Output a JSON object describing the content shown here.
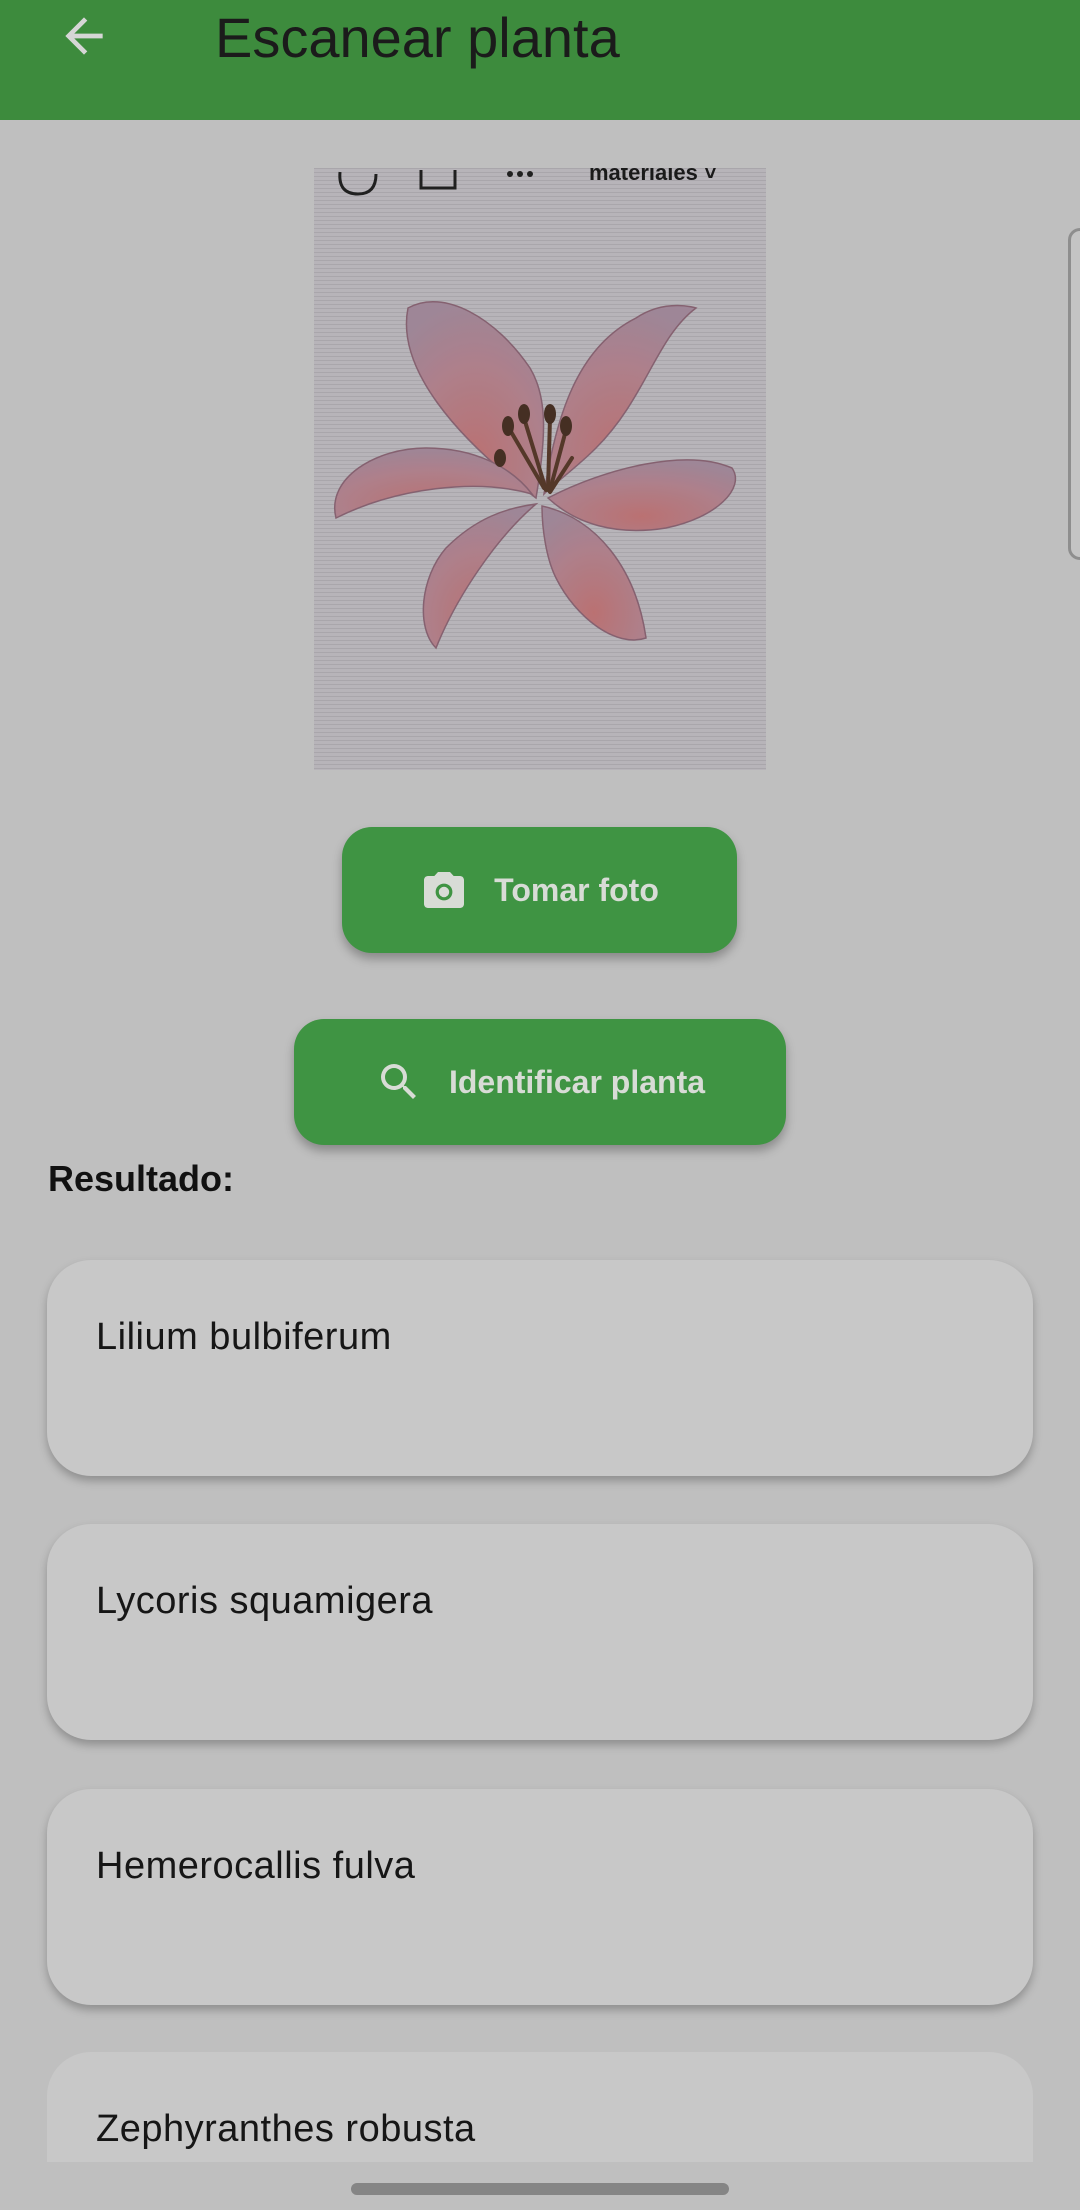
{
  "app_bar": {
    "title": "Escanear planta",
    "back_icon": "arrow-left-icon"
  },
  "photo": {
    "toolbar_text": "materiales ˅"
  },
  "actions": {
    "take_photo_label": "Tomar foto",
    "take_photo_icon": "camera-icon",
    "identify_label": "Identificar planta",
    "identify_icon": "search-icon"
  },
  "results": {
    "heading": "Resultado:",
    "items": [
      {
        "name": "Lilium bulbiferum"
      },
      {
        "name": "Lycoris squamigera"
      },
      {
        "name": "Hemerocallis fulva"
      },
      {
        "name": "Zephyranthes robusta"
      }
    ]
  },
  "colors": {
    "app_bar": "#3d8b3d",
    "button": "#3f9443",
    "background": "#bfbfbf",
    "card": "#c8c8c8"
  }
}
